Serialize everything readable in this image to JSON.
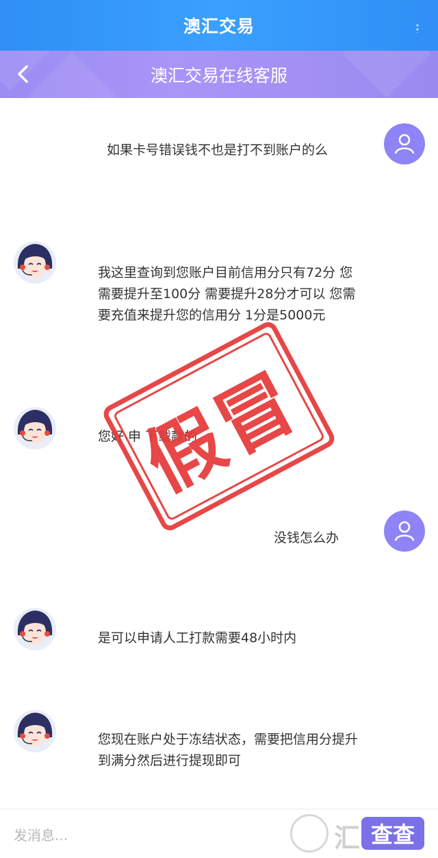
{
  "header": {
    "app_title": "澳汇交易",
    "page_title": "澳汇交易在线客服"
  },
  "messages": [
    {
      "sender": "user",
      "text": "如果卡号错误钱不也是打不到账户的么"
    },
    {
      "sender": "agent",
      "text": "我这里查询到您账户目前信用分只有72分  您需要提升至100分 需要提升28分才可以  您需要充值来提升您的信用分 1分是5000元"
    },
    {
      "sender": "agent",
      "text": "您好    申      下载款的"
    },
    {
      "sender": "user",
      "text": "没钱怎么办"
    },
    {
      "sender": "agent",
      "text": "是可以申请人工打款需要48小时内"
    },
    {
      "sender": "agent",
      "text": "您现在账户处于冻结状态，需要把信用分提升到满分然后进行提现即可"
    }
  ],
  "stamp": {
    "text": "假冒",
    "color": "#e63a3a"
  },
  "input": {
    "placeholder": "发消息..."
  },
  "watermark": {
    "prefix": "汇",
    "badge": "查查"
  },
  "colors": {
    "topbar": "#2f8ff5",
    "subbar": "#9b8cf3",
    "user_avatar": "#8e84f5"
  }
}
